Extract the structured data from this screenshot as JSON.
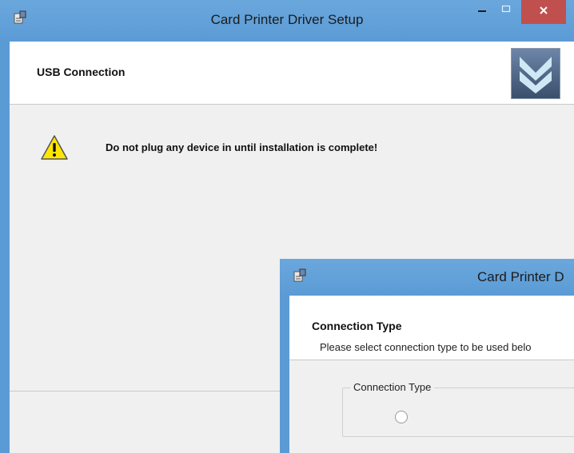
{
  "back_window": {
    "title": "Card Printer Driver Setup",
    "header_title": "USB Connection",
    "warning_text": "Do not plug any device in until installation is complete!",
    "icons": [
      "setup-app-icon",
      "minimize-icon",
      "maximize-icon",
      "close-icon",
      "warning-icon",
      "logo-icon"
    ]
  },
  "front_window": {
    "title": "Card Printer D",
    "header_title": "Connection Type",
    "instruction_text": "Please select connection type to be used belo",
    "group_label": "Connection Type",
    "icons": [
      "setup-app-icon"
    ]
  },
  "colors": {
    "titlebar": "#5b9bd5",
    "close_button": "#c0504d",
    "client_bg": "#f0f0f0",
    "header_bg": "#ffffff",
    "warning_yellow": "#ffe600"
  }
}
